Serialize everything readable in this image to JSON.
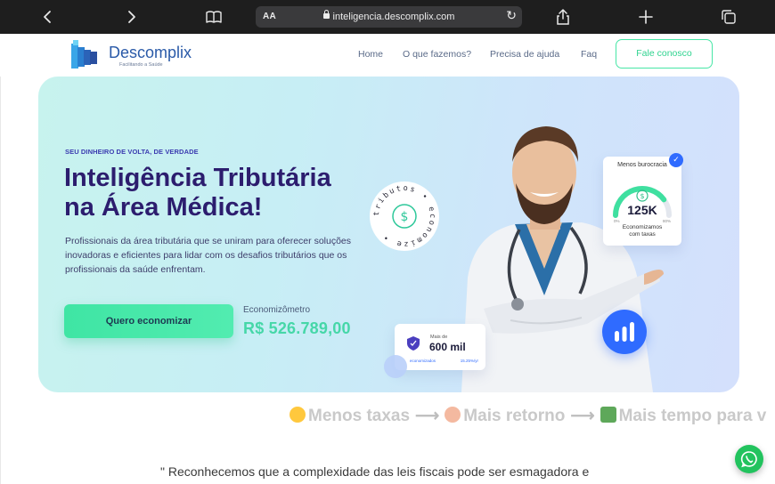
{
  "browser": {
    "aa_label": "AA",
    "url": "inteligencia.descomplix.com",
    "icons": [
      "back-icon",
      "forward-icon",
      "reader-icon",
      "lock-icon",
      "reload-icon",
      "share-icon",
      "new-tab-icon",
      "tabs-icon"
    ]
  },
  "header": {
    "logo_name": "Descomplix",
    "logo_tagline": "Facilitando a Saúde",
    "nav": [
      "Home",
      "O que fazemos?",
      "Precisa de ajuda",
      "Faq"
    ],
    "cta_label": "Fale conosco"
  },
  "hero": {
    "eyebrow": "SEU DINHEIRO DE VOLTA, DE VERDADE",
    "title_line1": "Inteligência Tributária",
    "title_line2": "na Área Médica!",
    "description": "Profissionais da área tributária que se uniram para oferecer soluções inovadoras e eficientes para lidar com os desafios tributários que os profissionais da saúde enfrentam.",
    "cta_label": "Quero economizar",
    "meter_label": "Economizômetro",
    "meter_value": "R$ 526.789,00",
    "stamp_text": "tributos • economize •"
  },
  "card_right": {
    "title": "Menos burocracia",
    "value": "125K",
    "pct_left": "0%",
    "pct_right": "80%",
    "caption_line1": "Economizamos",
    "caption_line2": "com taxas",
    "gauge_fraction": 0.8
  },
  "card_left": {
    "label": "Mais de",
    "value": "600 mil",
    "foot_left": "economizados",
    "foot_right": "15.25%/yr"
  },
  "marquee": {
    "item1": "Menos taxas",
    "item2": "Mais retorno",
    "item3": "Mais tempo para v",
    "arrow": "⟶"
  },
  "quote": "\" Reconhecemos que a complexidade das leis fiscais pode ser esmagadora e",
  "colors": {
    "brand": "#2a5aa8",
    "accent": "#47e6a6",
    "title": "#2c1d6e",
    "blue": "#2f6bff",
    "whatsapp": "#22c35e"
  }
}
